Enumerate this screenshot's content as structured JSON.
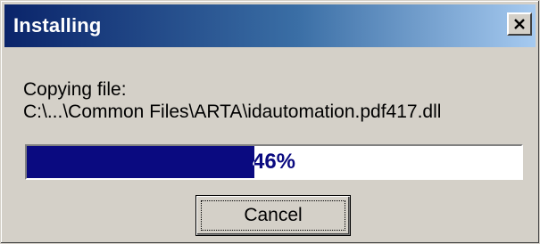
{
  "window": {
    "title": "Installing",
    "close_label": "close"
  },
  "content": {
    "status_label": "Copying file:",
    "file_path": "C:\\...\\Common Files\\ARTA\\idautomation.pdf417.dll"
  },
  "progress": {
    "percent": 46,
    "text": "46%",
    "fill_color": "#0a0a80"
  },
  "buttons": {
    "cancel_label": "Cancel"
  },
  "icons": {
    "close": "close-icon"
  }
}
